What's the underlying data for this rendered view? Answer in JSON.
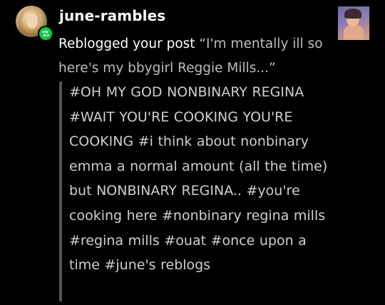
{
  "notification": {
    "username": "june-rambles",
    "avatar_icon": "user-avatar",
    "badge_icon": "reblog-icon",
    "badge_color": "#00cf35",
    "action_text": "Reblogged your post",
    "post_title": "“I'm mentally ill so here's my bbygirl Reggie Mills...”",
    "thumbnail_icon": "post-thumbnail"
  },
  "tags": [
    "#OH MY GOD NONBINARY REGINA",
    "#WAIT YOU'RE COOKING YOU'RE COOKING",
    "#i think about nonbinary emma a normal amount (all the time) but NONBINARY REGINA..",
    "#you're cooking here",
    "#nonbinary regina mills",
    "#regina mills",
    "#ouat",
    "#once upon a time",
    "#june's reblogs"
  ]
}
